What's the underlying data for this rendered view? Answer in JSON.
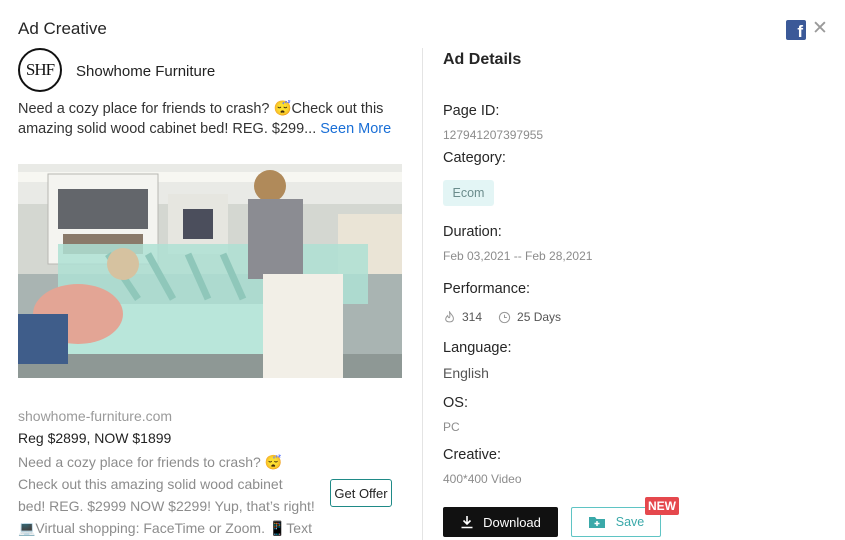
{
  "modal": {
    "title": "Ad Creative",
    "brand_icon": "facebook-icon",
    "close_icon": "close-icon"
  },
  "creative": {
    "page_name": "Showhome Furniture",
    "avatar_text": "SHF",
    "post_text": "Need a cozy place for friends to crash? 😴Check out this amazing solid wood cabinet bed! REG. $299...",
    "see_more": "Seen More",
    "image_description": "video-thumbnail",
    "domain": "showhome-furniture.com",
    "headline": "Reg $2899, NOW $1899",
    "description_lines": [
      "Need a cozy place for friends to crash? 😴",
      "Check out this amazing solid wood cabinet",
      "bed! REG. $2999 NOW $2299! Yup, that’s right!",
      "💻Virtual shopping: FaceTime or Zoom. 📱Text"
    ],
    "cta": "Get Offer"
  },
  "details": {
    "title": "Ad Details",
    "page_id_label": "Page ID:",
    "page_id": "127941207397955",
    "category_label": "Category:",
    "category": "Ecom",
    "duration_label": "Duration:",
    "duration": "Feb 03,2021 -- Feb 28,2021",
    "performance_label": "Performance:",
    "likes": "314",
    "days": "25 Days",
    "language_label": "Language:",
    "language": "English",
    "os_label": "OS:",
    "os": "PC",
    "creative_label": "Creative:",
    "creative": "400*400 Video"
  },
  "actions": {
    "download": "Download",
    "save": "Save",
    "new_badge": "NEW"
  },
  "colors": {
    "accent": "#5fc4c4",
    "facebook": "#3b5998",
    "link": "#1a6fd6",
    "badge_new": "#e5484d"
  }
}
